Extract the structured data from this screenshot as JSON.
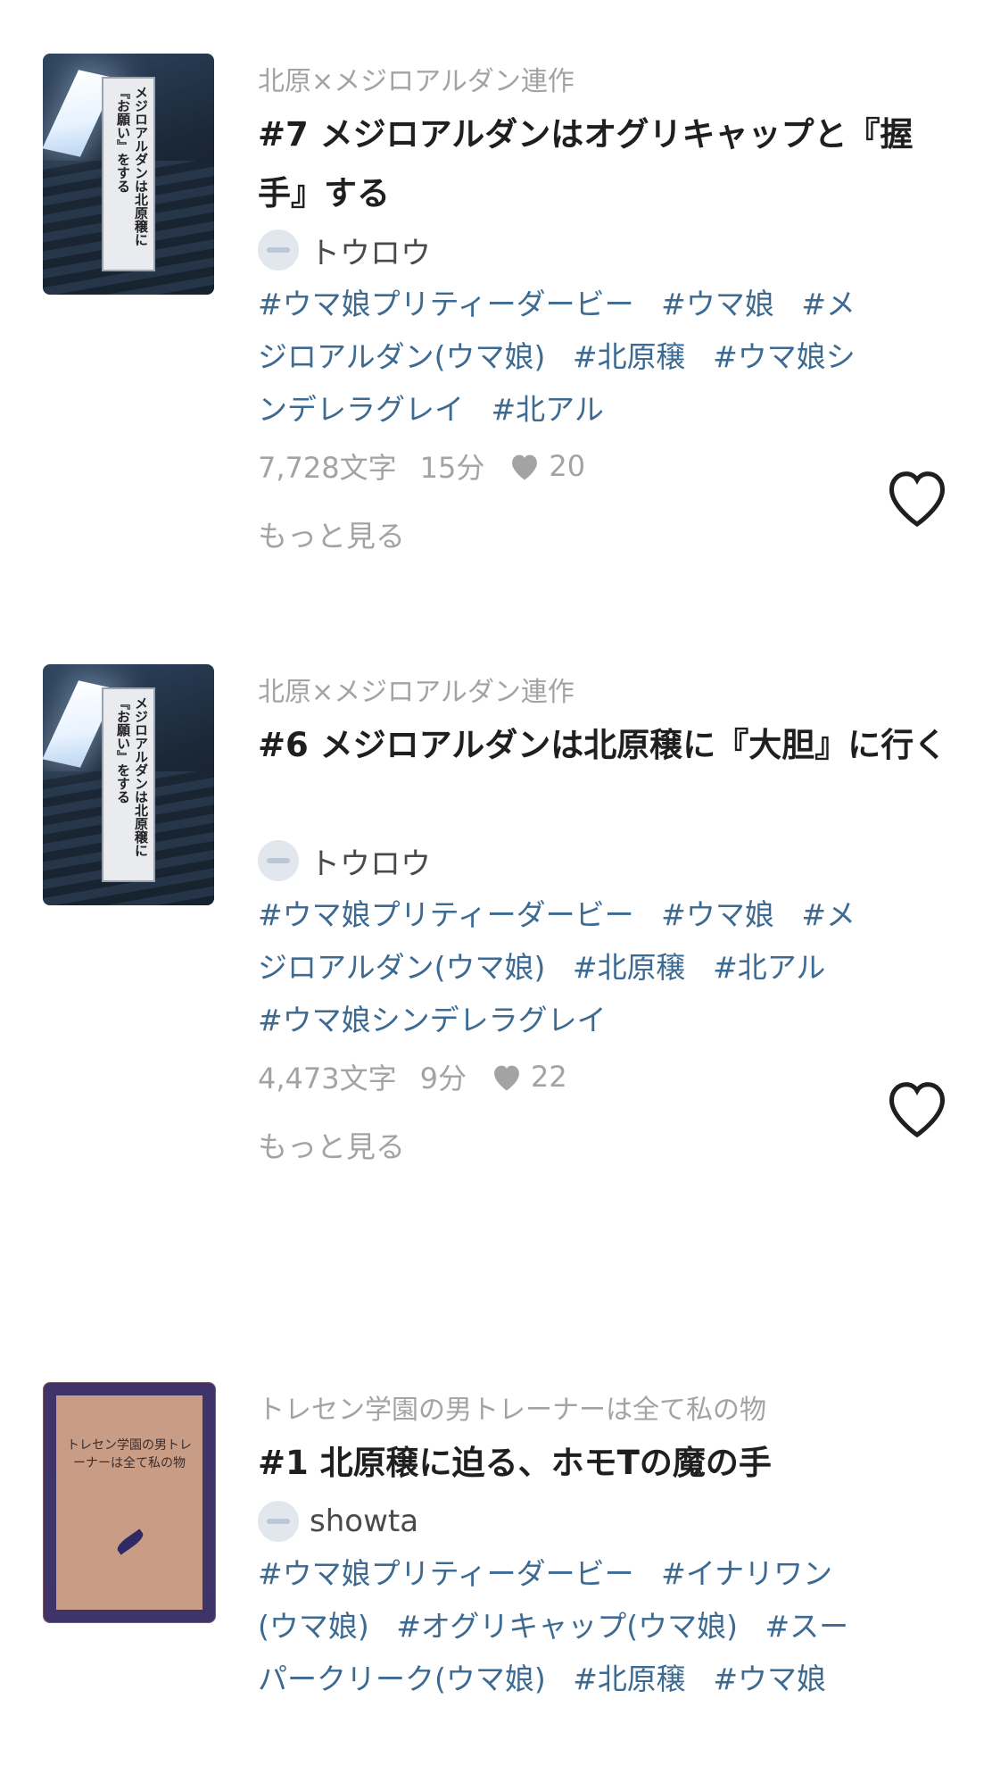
{
  "items": [
    {
      "series": "北原×メジロアルダン連作",
      "title": "#7 メジロアルダンはオグリキャップと『握手』する",
      "cover_text": "メジロアルダンは北原穣に『お願い』をする",
      "author": "トウロウ",
      "tags": [
        "#ウマ娘プリティーダービー",
        "#ウマ娘",
        "#メジロアルダン(ウマ娘)",
        "#北原穣",
        "#ウマ娘シンデレラグレイ",
        "#北アル"
      ],
      "chars": "7,728文字",
      "time": "15分",
      "likes": "20",
      "more": "もっと見る"
    },
    {
      "series": "北原×メジロアルダン連作",
      "title": "#6 メジロアルダンは北原穣に『大胆』に行く",
      "cover_text": "メジロアルダンは北原穣に『お願い』をする",
      "author": "トウロウ",
      "tags": [
        "#ウマ娘プリティーダービー",
        "#ウマ娘",
        "#メジロアルダン(ウマ娘)",
        "#北原穣",
        "#北アル",
        "#ウマ娘シンデレラグレイ"
      ],
      "chars": "4,473文字",
      "time": "9分",
      "likes": "22",
      "more": "もっと見る"
    },
    {
      "series": "トレセン学園の男トレーナーは全て私の物",
      "title": "#1 北原穣に迫る、ホモTの魔の手",
      "cover_text": "トレセン学園の男トレーナーは全て私の物",
      "author": "showta",
      "tags": [
        "#ウマ娘プリティーダービー",
        "#イナリワン(ウマ娘)",
        "#オグリキャップ(ウマ娘)",
        "#スーパークリーク(ウマ娘)",
        "#北原穣",
        "#ウマ娘"
      ]
    }
  ]
}
